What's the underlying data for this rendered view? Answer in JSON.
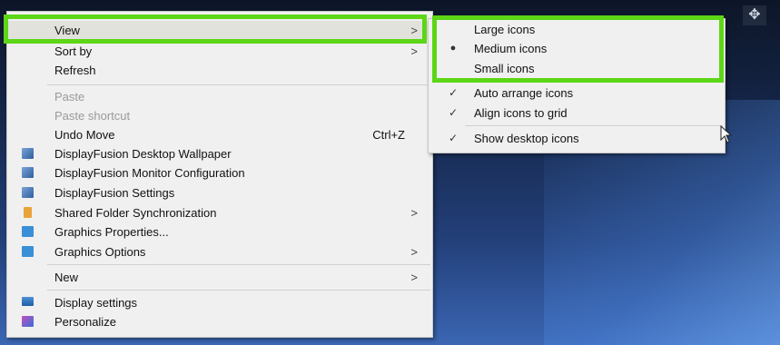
{
  "main_menu": {
    "view": {
      "label": "View",
      "arrow": ">"
    },
    "sort_by": {
      "label": "Sort by",
      "arrow": ">"
    },
    "refresh": {
      "label": "Refresh"
    },
    "paste": {
      "label": "Paste"
    },
    "paste_shortcut": {
      "label": "Paste shortcut"
    },
    "undo_move": {
      "label": "Undo Move",
      "shortcut": "Ctrl+Z"
    },
    "df_wallpaper": {
      "label": "DisplayFusion Desktop Wallpaper",
      "icon": "displayfusion-icon"
    },
    "df_monitor": {
      "label": "DisplayFusion Monitor Configuration",
      "icon": "displayfusion-icon"
    },
    "df_settings": {
      "label": "DisplayFusion Settings",
      "icon": "displayfusion-icon"
    },
    "shared_folder": {
      "label": "Shared Folder Synchronization",
      "arrow": ">",
      "icon": "sync-folder-icon"
    },
    "graphics_properties": {
      "label": "Graphics Properties...",
      "icon": "intel-graphics-icon"
    },
    "graphics_options": {
      "label": "Graphics Options",
      "arrow": ">",
      "icon": "intel-graphics-icon"
    },
    "new": {
      "label": "New",
      "arrow": ">"
    },
    "display_settings": {
      "label": "Display settings",
      "icon": "display-icon"
    },
    "personalize": {
      "label": "Personalize",
      "icon": "personalize-icon"
    }
  },
  "view_submenu": {
    "large_icons": {
      "label": "Large icons"
    },
    "medium_icons": {
      "label": "Medium icons",
      "mark": "●"
    },
    "small_icons": {
      "label": "Small icons"
    },
    "auto_arrange": {
      "label": "Auto arrange icons",
      "mark": "✓"
    },
    "align_grid": {
      "label": "Align icons to grid",
      "mark": "✓"
    },
    "show_desktop_icons": {
      "label": "Show desktop icons",
      "mark": "✓"
    }
  },
  "colors": {
    "highlight_border": "#5cd616",
    "menu_background": "#f0f0f0",
    "disabled_text": "#9a9a9a"
  },
  "misc": {
    "move_icon": "move-arrows-icon"
  }
}
